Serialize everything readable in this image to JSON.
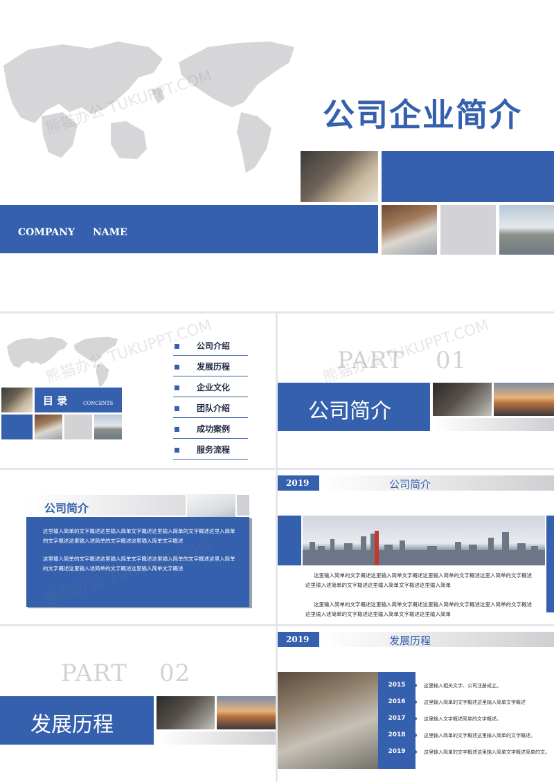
{
  "cover": {
    "title": "公司企业简介",
    "company_word": "COMPANY",
    "name_word": "NAME"
  },
  "toc": {
    "title": "目 录",
    "subtitle": "CONCENTS",
    "items": [
      "公司介绍",
      "发展历程",
      "企业文化",
      "团队介绍",
      "成功案例",
      "服务流程"
    ]
  },
  "part1": {
    "part_word": "PART",
    "part_num": "01",
    "title": "公司简介"
  },
  "intro_card": {
    "title": "公司简介",
    "para1": "这里输入简单的文字概述这里输入简单文字概述这里输入简单的文字概述这里入简单的文字概述这里输入述简单的文字概述这里输入简单文字概述",
    "para2": "这里输入简单的文字概述这里输入简单文字概述这里输入简单的文字概述这里入简单的文字概述这里输入述简单的文字概述这里输入简单文字概述"
  },
  "city_slide": {
    "year": "2019",
    "title": "公司简介",
    "para1_line1": "这里输入简单的文字概述这里输入简单文字概述这里输入简单的文字概述这里入简单的文字概述",
    "para1_line2": "这里输入述简单的文字概述这里输入简单文字概述这里输入简单",
    "para2_line1": "这里输入简单的文字概述这里输入简单文字概述这里输入简单的文字概述这里入简单的文字概述",
    "para2_line2": "这里输入述简单的文字概述这里输入简单文字概述这里输入简单"
  },
  "part2": {
    "part_word": "PART",
    "part_num": "02",
    "title": "发展历程"
  },
  "timeline_slide": {
    "year": "2019",
    "title": "发展历程",
    "entries": [
      {
        "year": "2015",
        "text": "这里输入相关文字、公司注册成立。"
      },
      {
        "year": "2016",
        "text": "这里输入简单的文字概述这里输入简单文字概述"
      },
      {
        "year": "2017",
        "text": "这里输入文字概述简单的文字概述。"
      },
      {
        "year": "2018",
        "text": "这里输入简单的文字概述这里输入简单的文字概述。"
      },
      {
        "year": "2019",
        "text": "这里输入简单的文字概述这里输入简单文字概述简单的文。"
      }
    ]
  },
  "watermark": "熊猫办公 TUKUPPT.COM",
  "colors": {
    "accent": "#3460ad",
    "grey": "#d3d3d5"
  }
}
